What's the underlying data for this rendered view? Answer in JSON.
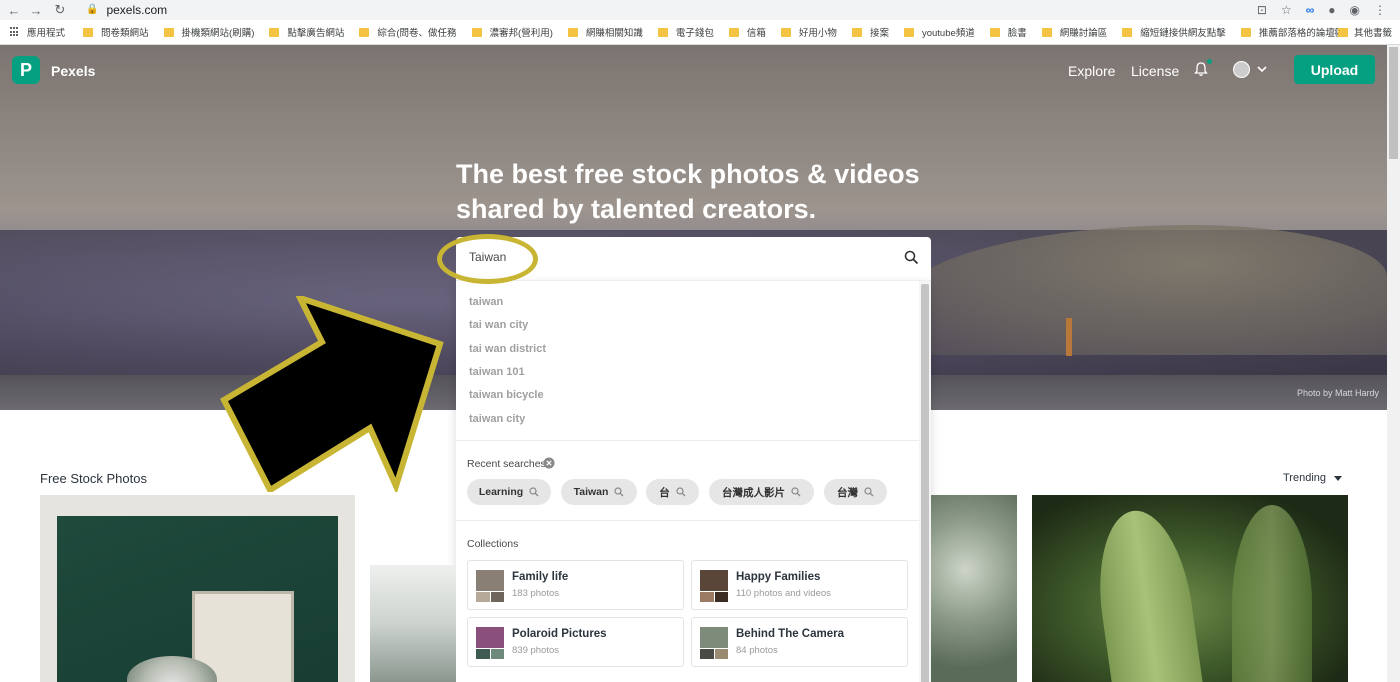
{
  "browser": {
    "url": "pexels.com",
    "bookmarks": [
      "應用程式",
      "問卷類網站",
      "掛機類網站(刷購)",
      "點擊廣告網站",
      "綜合(問卷、做任務",
      "濃審邦(營利用)",
      "網賺相關知識",
      "電子錢包",
      "信箱",
      "好用小物",
      "接案",
      "youtube頻道",
      "臉書",
      "網賺討論區",
      "縮短鏈接供網友點擊",
      "推薦部落格的論壇區"
    ],
    "other_bookmarks": "其他書籤"
  },
  "nav": {
    "brand": "Pexels",
    "logo_letter": "P",
    "explore": "Explore",
    "license": "License",
    "upload": "Upload"
  },
  "hero": {
    "title": "The best free stock photos & videos shared by talented creators.",
    "photo_credit": "Photo by Matt Hardy"
  },
  "search": {
    "value": "Taiwan",
    "suggestions": [
      "taiwan",
      "tai wan city",
      "tai wan district",
      "taiwan 101",
      "taiwan bicycle",
      "taiwan city"
    ],
    "recent_label": "Recent searches",
    "recent": [
      "Learning",
      "Taiwan",
      "台",
      "台灣成人影片",
      "台灣"
    ],
    "collections_label": "Collections",
    "collections": [
      {
        "title": "Family life",
        "sub": "183 photos"
      },
      {
        "title": "Happy Families",
        "sub": "110 photos and videos"
      },
      {
        "title": "Polaroid Pictures",
        "sub": "839 photos"
      },
      {
        "title": "Behind The Camera",
        "sub": "84 photos"
      }
    ]
  },
  "feed": {
    "title": "Free Stock Photos",
    "sort": "Trending"
  },
  "colors": {
    "brand": "#05a081",
    "highlight": "#c8b533"
  }
}
